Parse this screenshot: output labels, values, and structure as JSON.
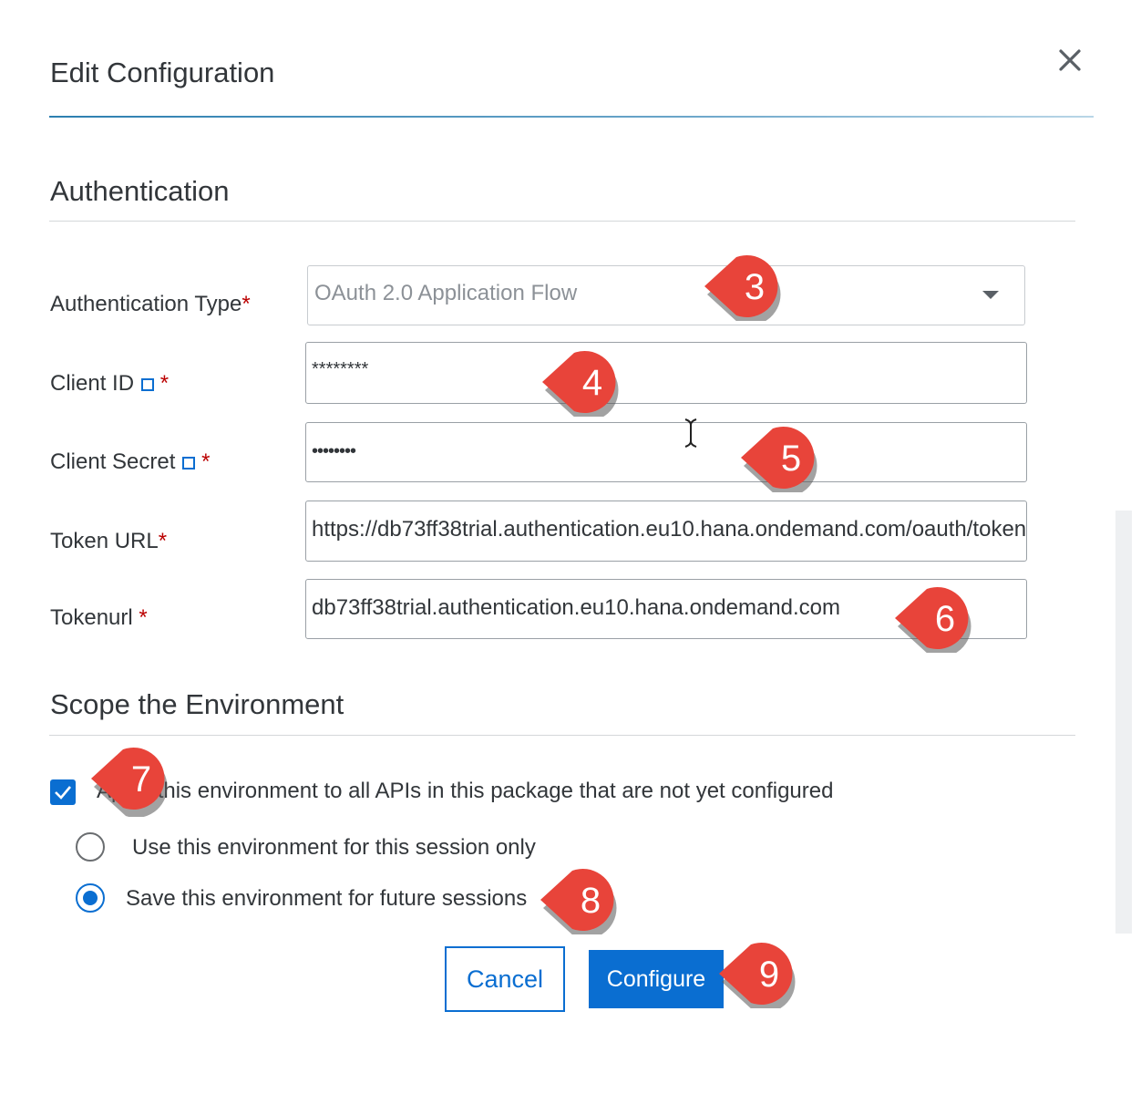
{
  "dialog": {
    "title": "Edit Configuration",
    "close_icon": "close-icon"
  },
  "authentication": {
    "heading": "Authentication",
    "type_label": "Authentication Type",
    "type_value": "OAuth 2.0 Application Flow",
    "client_id_label": "Client ID",
    "client_id_value": "********",
    "client_secret_label": "Client Secret",
    "client_secret_value": "••••••••",
    "token_url_label": "Token URL",
    "token_url_value": "https://db73ff38trial.authentication.eu10.hana.ondemand.com/oauth/token",
    "tokenurl_label": "Tokenurl",
    "tokenurl_value": "db73ff38trial.authentication.eu10.hana.ondemand.com",
    "required_marker": "*"
  },
  "scope": {
    "heading": "Scope the Environment",
    "apply_all_label": "Apply this environment to all APIs in this package that are not yet configured",
    "apply_all_checked": true,
    "session_only_label": "Use this environment for this session only",
    "future_sessions_label": "Save this environment for future sessions",
    "selected_option": "future_sessions"
  },
  "buttons": {
    "cancel_label": "Cancel",
    "configure_label": "Configure"
  },
  "callouts": [
    "3",
    "4",
    "5",
    "6",
    "7",
    "8",
    "9"
  ],
  "colors": {
    "accent": "#0a6ed1",
    "required": "#bb0000",
    "callout": "#e8443a"
  }
}
